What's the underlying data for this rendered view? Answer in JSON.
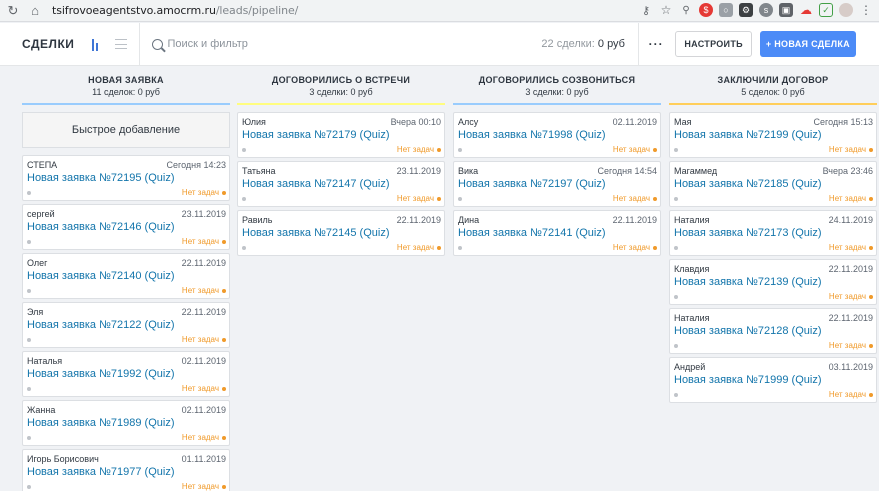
{
  "browser": {
    "url_host": "tsifrovoeagentstvo.amocrm.ru",
    "url_path": "/leads/pipeline/"
  },
  "header": {
    "title": "СДЕЛКИ",
    "search_placeholder": "Поиск и фильтр",
    "summary_count": "22 сделки:",
    "summary_sum": "0 руб",
    "more_label": "···",
    "settings_label": "НАСТРОИТЬ",
    "new_deal_label": "+ НОВАЯ СДЕЛКА"
  },
  "quick_add_label": "Быстрое добавление",
  "no_task_label": "Нет задач",
  "colors": {
    "accent": "#4c8bf7",
    "link": "#1375ab",
    "warning": "#f09a2a",
    "col_new": "#99ccfd",
    "col_meet": "#fffd7f",
    "col_call": "#99ccfd",
    "col_contract": "#ffce5a"
  },
  "columns": [
    {
      "title": "НОВАЯ ЗАЯВКА",
      "subtitle": "11 сделок: 0 руб",
      "has_quick_add": true,
      "cards": [
        {
          "contact": "СТЕПА",
          "date": "Сегодня 14:23",
          "name": "Новая заявка №72195 (Quiz)"
        },
        {
          "contact": "сергей",
          "date": "23.11.2019",
          "name": "Новая заявка №72146 (Quiz)"
        },
        {
          "contact": "Олег",
          "date": "22.11.2019",
          "name": "Новая заявка №72140 (Quiz)"
        },
        {
          "contact": "Эля",
          "date": "22.11.2019",
          "name": "Новая заявка №72122 (Quiz)"
        },
        {
          "contact": "Наталья",
          "date": "02.11.2019",
          "name": "Новая заявка №71992 (Quiz)"
        },
        {
          "contact": "Жанна",
          "date": "02.11.2019",
          "name": "Новая заявка №71989 (Quiz)"
        },
        {
          "contact": "Игорь Борисович",
          "date": "01.11.2019",
          "name": "Новая заявка №71977 (Quiz)"
        }
      ]
    },
    {
      "title": "ДОГОВОРИЛИСЬ О ВСТРЕЧИ",
      "subtitle": "3 сделки: 0 руб",
      "has_quick_add": false,
      "cards": [
        {
          "contact": "Юлия",
          "date": "Вчера 00:10",
          "name": "Новая заявка №72179 (Quiz)"
        },
        {
          "contact": "Татьяна",
          "date": "23.11.2019",
          "name": "Новая заявка №72147 (Quiz)"
        },
        {
          "contact": "Равиль",
          "date": "22.11.2019",
          "name": "Новая заявка №72145 (Quiz)"
        }
      ]
    },
    {
      "title": "ДОГОВОРИЛИСЬ СОЗВОНИТЬСЯ",
      "subtitle": "3 сделки: 0 руб",
      "has_quick_add": false,
      "cards": [
        {
          "contact": "Алсу",
          "date": "02.11.2019",
          "name": "Новая заявка №71998 (Quiz)"
        },
        {
          "contact": "Вика",
          "date": "Сегодня 14:54",
          "name": "Новая заявка №72197 (Quiz)"
        },
        {
          "contact": "Дина",
          "date": "22.11.2019",
          "name": "Новая заявка №72141 (Quiz)"
        }
      ]
    },
    {
      "title": "ЗАКЛЮЧИЛИ ДОГОВОР",
      "subtitle": "5 сделок: 0 руб",
      "has_quick_add": false,
      "cards": [
        {
          "contact": "Мая",
          "date": "Сегодня 15:13",
          "name": "Новая заявка №72199 (Quiz)"
        },
        {
          "contact": "Магаммед",
          "date": "Вчера 23:46",
          "name": "Новая заявка №72185 (Quiz)"
        },
        {
          "contact": "Наталия",
          "date": "24.11.2019",
          "name": "Новая заявка №72173 (Quiz)"
        },
        {
          "contact": "Клавдия",
          "date": "22.11.2019",
          "name": "Новая заявка №72139 (Quiz)"
        },
        {
          "contact": "Наталия",
          "date": "22.11.2019",
          "name": "Новая заявка №72128 (Quiz)"
        },
        {
          "contact": "Андрей",
          "date": "03.11.2019",
          "name": "Новая заявка №71999 (Quiz)"
        }
      ]
    }
  ]
}
